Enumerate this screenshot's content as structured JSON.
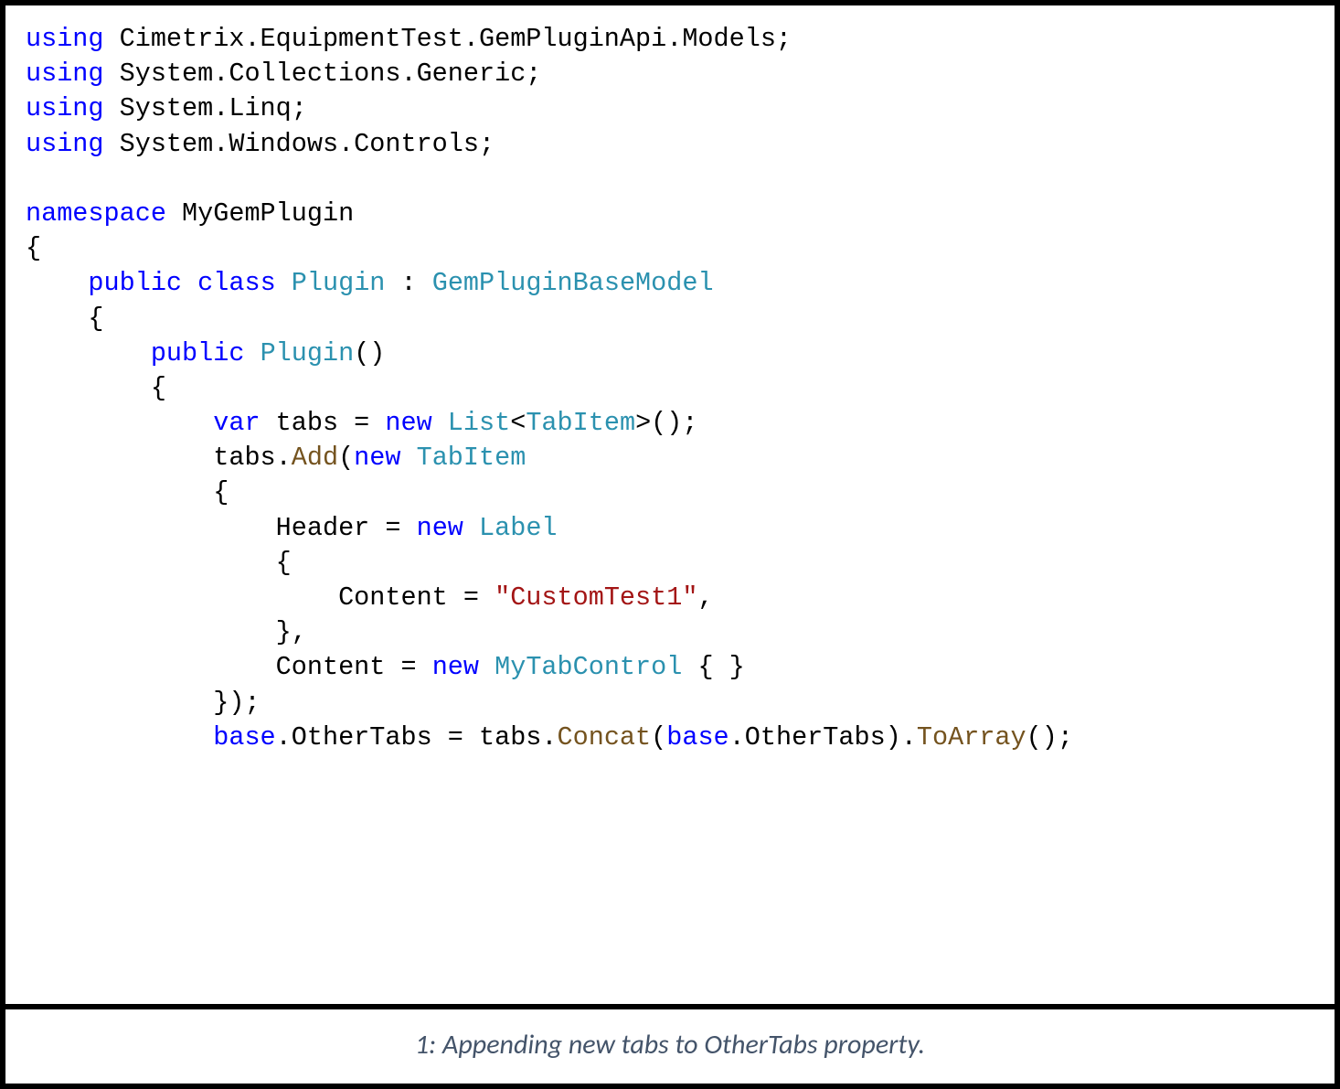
{
  "code": {
    "kw_using": "using",
    "ns1": " Cimetrix.EquipmentTest.GemPluginApi.Models;",
    "ns2": " System.Collections.Generic;",
    "ns3": " System.Linq;",
    "ns4": " System.Windows.Controls;",
    "kw_namespace": "namespace",
    "namespace_name": " MyGemPlugin",
    "open_brace": "{",
    "indent1": "    ",
    "kw_public": "public",
    "kw_class": "class",
    "class_name": "Plugin",
    "colon": " : ",
    "base_class": "GemPluginBaseModel",
    "indent2": "        ",
    "ctor_name": "Plugin",
    "ctor_parens": "()",
    "indent3": "            ",
    "kw_var": "var",
    "tabs_eq": " tabs = ",
    "kw_new": "new",
    "sp": " ",
    "type_list": "List",
    "lt": "<",
    "type_tabitem": "TabItem",
    "gt_parens": ">();",
    "tabs_dot": "tabs.",
    "mbr_add": "Add",
    "open_paren": "(",
    "indent3b": "            {",
    "indent4": "                ",
    "header_eq": "Header = ",
    "type_label": "Label",
    "indent4b": "                {",
    "indent5": "                    ",
    "content_eq": "Content = ",
    "str_custom": "\"CustomTest1\"",
    "comma": ",",
    "indent4c": "                },",
    "type_mytab": "MyTabControl",
    "empty_braces": " { }",
    "indent3c": "            });",
    "kw_base": "base",
    "dot_othertabs_eq": ".OtherTabs = tabs.",
    "mbr_concat": "Concat",
    "dot_othertabs": ".OtherTabs).",
    "mbr_toarray": "ToArray",
    "end_stmt": "();",
    "close_paren": ")"
  },
  "caption": "1: Appending new tabs to OtherTabs property."
}
